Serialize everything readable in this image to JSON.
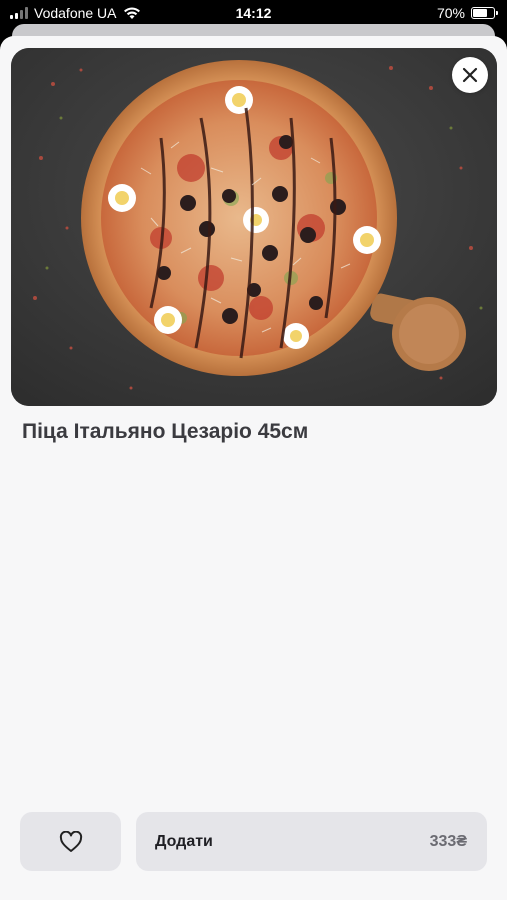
{
  "status_bar": {
    "carrier": "Vodafone UA",
    "time": "14:12",
    "battery": "70%",
    "battery_level": 0.7
  },
  "product": {
    "title": "Піца Італьяно Цезаріо 45см",
    "image_icon": "pizza-photo"
  },
  "actions": {
    "add_label": "Додати",
    "price": "333₴",
    "favorite_icon": "heart-icon",
    "close_icon": "close-icon"
  },
  "colors": {
    "sheet_bg": "#f7f7f8",
    "button_bg": "#e5e5e9",
    "title_text": "#3b3b40"
  }
}
